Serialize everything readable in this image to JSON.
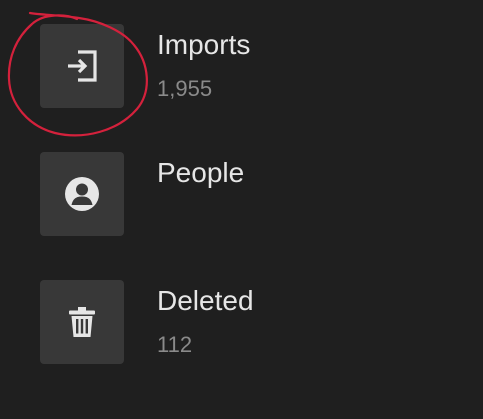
{
  "items": [
    {
      "label": "Imports",
      "count": "1,955",
      "icon": "import-icon"
    },
    {
      "label": "People",
      "count": "",
      "icon": "person-icon"
    },
    {
      "label": "Deleted",
      "count": "112",
      "icon": "trash-icon"
    }
  ],
  "annotation": {
    "color": "#d4213c"
  },
  "colors": {
    "background": "#1f1f1f",
    "tile": "#383838",
    "icon": "#e6e6e6",
    "label": "#e6e6e6",
    "count": "#8a8a8a"
  }
}
